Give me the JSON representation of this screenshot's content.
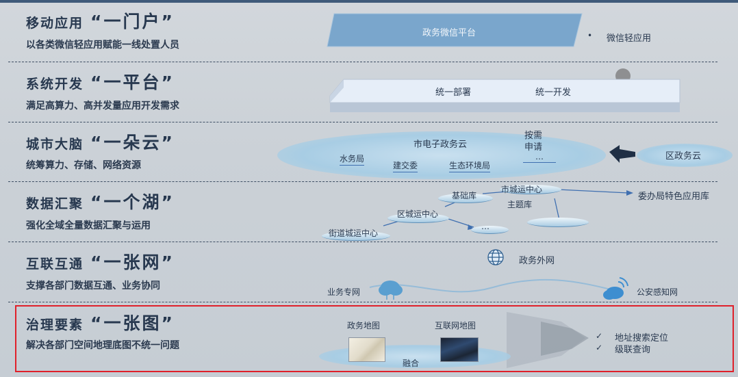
{
  "bands": [
    {
      "title": "移动应用",
      "highlight": "“一门户”",
      "subtitle": "以各类微信轻应用赋能一线处置人员"
    },
    {
      "title": "系统开发",
      "highlight": "“一平台”",
      "subtitle": "满足高算力、高并发量应用开发需求"
    },
    {
      "title": "城市大脑",
      "highlight": "“一朵云”",
      "subtitle": "统筹算力、存储、网络资源"
    },
    {
      "title": "数据汇聚",
      "highlight": "“一个湖”",
      "subtitle": "强化全域全量数据汇聚与运用"
    },
    {
      "title": "互联互通",
      "highlight": "“一张网”",
      "subtitle": "支撑各部门数据互通、业务协同"
    },
    {
      "title": "治理要素",
      "highlight": "“一张图”",
      "subtitle": "解决各部门空间地理底图不统一问题"
    }
  ],
  "portal": {
    "platform": "政务微信平台",
    "bullet": "•",
    "app": "微信轻应用"
  },
  "platform": {
    "deploy": "统一部署",
    "develop": "统一开发"
  },
  "cloud": {
    "city_cloud": "市电子政务云",
    "on_demand": "按需\n申请",
    "on_demand_l1": "按需",
    "on_demand_l2": "申请",
    "water": "水务局",
    "construction": "建交委",
    "ecology": "生态环境局",
    "ellipsis": "…",
    "district_cloud": "区政务云"
  },
  "lake": {
    "base_db": "基础库",
    "city_center": "市城运中心",
    "topic_db": "主题库",
    "district_center": "区城运中心",
    "street_center": "街道城运中心",
    "ellipsis": "…",
    "bureau_db": "委办局特色应用库"
  },
  "network": {
    "gov_extranet": "政务外网",
    "business_net": "业务专网",
    "police_net": "公安感知网"
  },
  "map": {
    "gov_map": "政务地图",
    "internet_map": "互联网地图",
    "fusion": "融合",
    "check": "✓",
    "features": [
      "地址搜索定位",
      "级联查询"
    ]
  },
  "colors": {
    "highlight_box": "#e0202a",
    "accent_blue": "#3f6fb0"
  }
}
